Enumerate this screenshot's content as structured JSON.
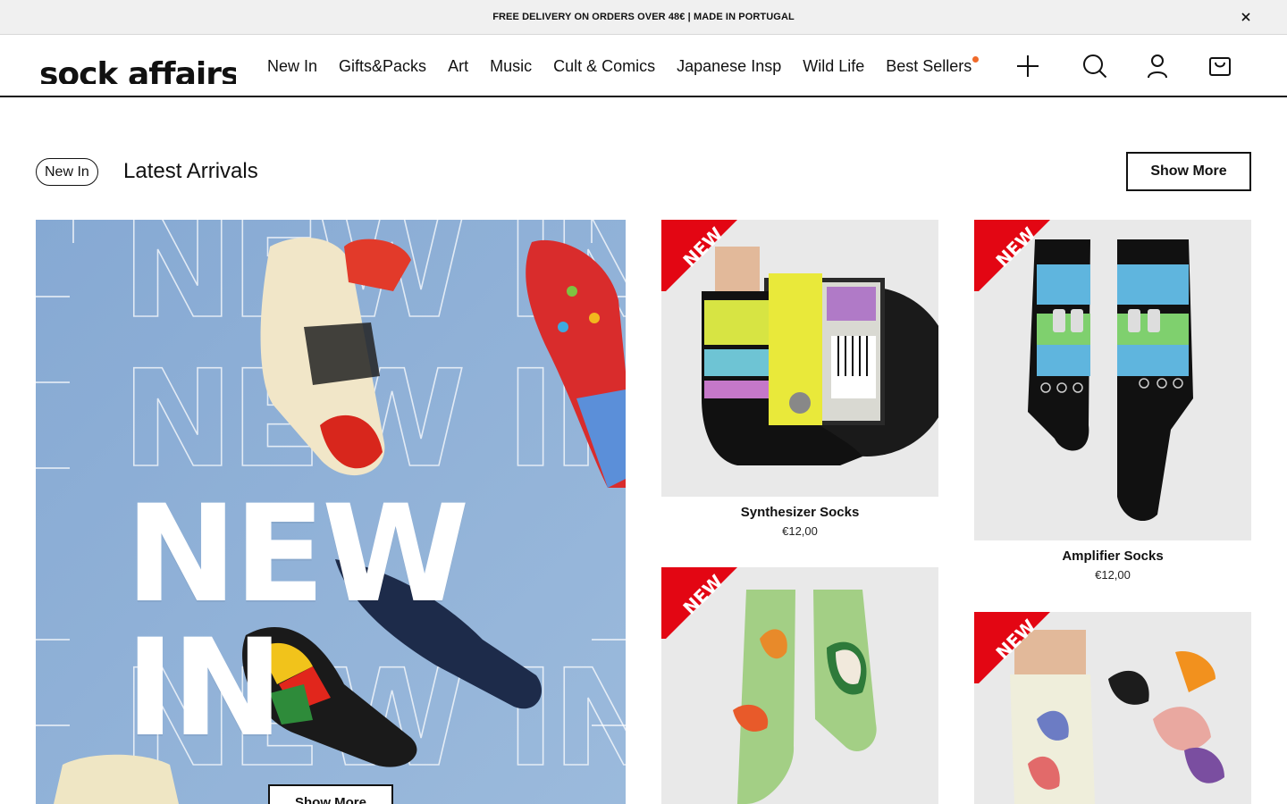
{
  "announcement": {
    "text": "FREE DELIVERY ON ORDERS OVER 48€ | MADE IN PORTUGAL"
  },
  "header": {
    "logo": "sock affairs",
    "nav": [
      "New In",
      "Gifts&Packs",
      "Art",
      "Music",
      "Cult & Comics",
      "Japanese Insp",
      "Wild Life",
      "Best Sellers"
    ],
    "icons": [
      "plus-icon",
      "search-icon",
      "user-icon",
      "cart-icon"
    ]
  },
  "section": {
    "badge": "New In",
    "title": "Latest Arrivals",
    "show_more": "Show More"
  },
  "hero": {
    "title": "NEW IN",
    "button": "Show More"
  },
  "products": [
    {
      "name": "Synthesizer Socks",
      "price": "€12,00",
      "ribbon": "NEW"
    },
    {
      "name": "Amplifier Socks",
      "price": "€12,00",
      "ribbon": "NEW"
    },
    {
      "name": "",
      "price": "",
      "ribbon": "NEW"
    },
    {
      "name": "",
      "price": "",
      "ribbon": "NEW"
    }
  ],
  "colors": {
    "ribbon": "#e30613",
    "hero_bg": "#8fb0d6",
    "accent_dot": "#f06a2a"
  }
}
